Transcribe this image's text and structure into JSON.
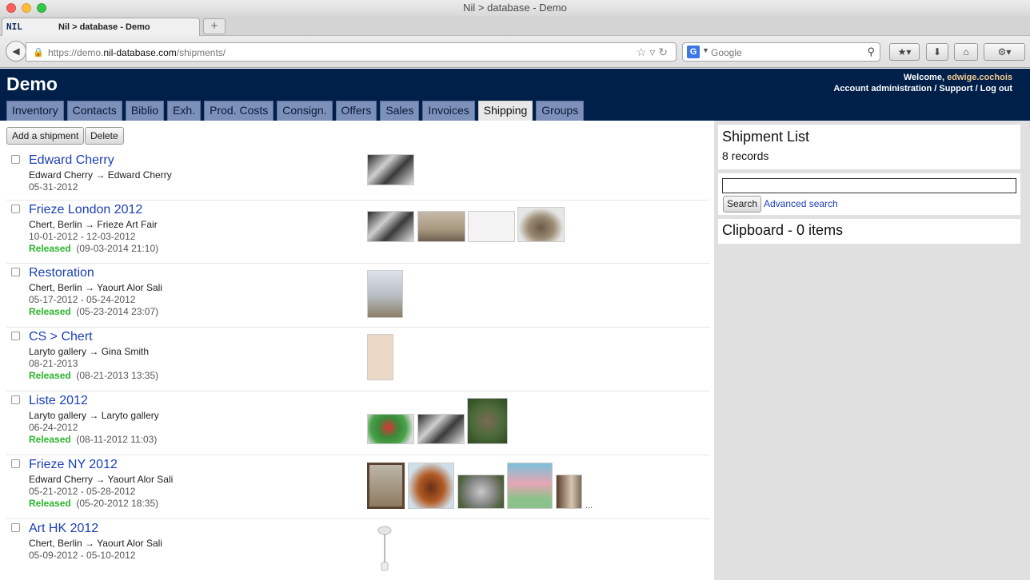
{
  "browser": {
    "window_title": "Nil > database - Demo",
    "tab_title": "Nil > database - Demo",
    "tab_logo": "NIL",
    "url_prefix": "https://demo.",
    "url_host": "nil-database.com",
    "url_path": "/shipments/",
    "search_placeholder": "Google",
    "search_engine_icon": "G"
  },
  "site": {
    "title": "Demo",
    "welcome_label": "Welcome,",
    "username": "edwige.cochois",
    "account_links": "Account administration / Support / Log out"
  },
  "nav": {
    "tabs": [
      {
        "label": "Inventory"
      },
      {
        "label": "Contacts"
      },
      {
        "label": "Biblio"
      },
      {
        "label": "Exh."
      },
      {
        "label": "Prod. Costs"
      },
      {
        "label": "Consign."
      },
      {
        "label": "Offers"
      },
      {
        "label": "Sales"
      },
      {
        "label": "Invoices"
      },
      {
        "label": "Shipping"
      },
      {
        "label": "Groups"
      }
    ],
    "active": "Shipping"
  },
  "toolbar": {
    "add_label": "Add a shipment",
    "delete_label": "Delete"
  },
  "shipments": [
    {
      "title": "Edward Cherry",
      "route": "Edward Cherry → Edward Cherry",
      "dates": "05-31-2012",
      "status": "",
      "timestamp": ""
    },
    {
      "title": "Frieze London 2012",
      "route": "Chert, Berlin → Frieze Art Fair",
      "dates": "10-01-2012 - 12-03-2012",
      "status": "Released",
      "timestamp": "(09-03-2014 21:10)"
    },
    {
      "title": "Restoration",
      "route": "Chert, Berlin → Yaourt Alor Sali",
      "dates": "05-17-2012 - 05-24-2012",
      "status": "Released",
      "timestamp": "(05-23-2014 23:07)"
    },
    {
      "title": "CS > Chert",
      "route": "Laryto gallery → Gina Smith",
      "dates": "08-21-2013",
      "status": "Released",
      "timestamp": "(08-21-2013 13:35)"
    },
    {
      "title": "Liste 2012",
      "route": "Laryto gallery → Laryto gallery",
      "dates": "06-24-2012",
      "status": "Released",
      "timestamp": "(08-11-2012 11:03)"
    },
    {
      "title": "Frieze NY 2012",
      "route": "Edward Cherry → Yaourt Alor Sali",
      "dates": "05-21-2012 - 05-28-2012",
      "status": "Released",
      "timestamp": "(05-20-2012 18:35)"
    },
    {
      "title": "Art HK 2012",
      "route": "Chert, Berlin → Yaourt Alor Sali",
      "dates": "05-09-2012 - 05-10-2012",
      "status": "",
      "timestamp": ""
    }
  ],
  "more_indicator": "...",
  "sidebar": {
    "list_title": "Shipment List",
    "record_count": "8 records",
    "search_button": "Search",
    "advanced_search": "Advanced search",
    "clipboard_title": "Clipboard - 0 items"
  }
}
